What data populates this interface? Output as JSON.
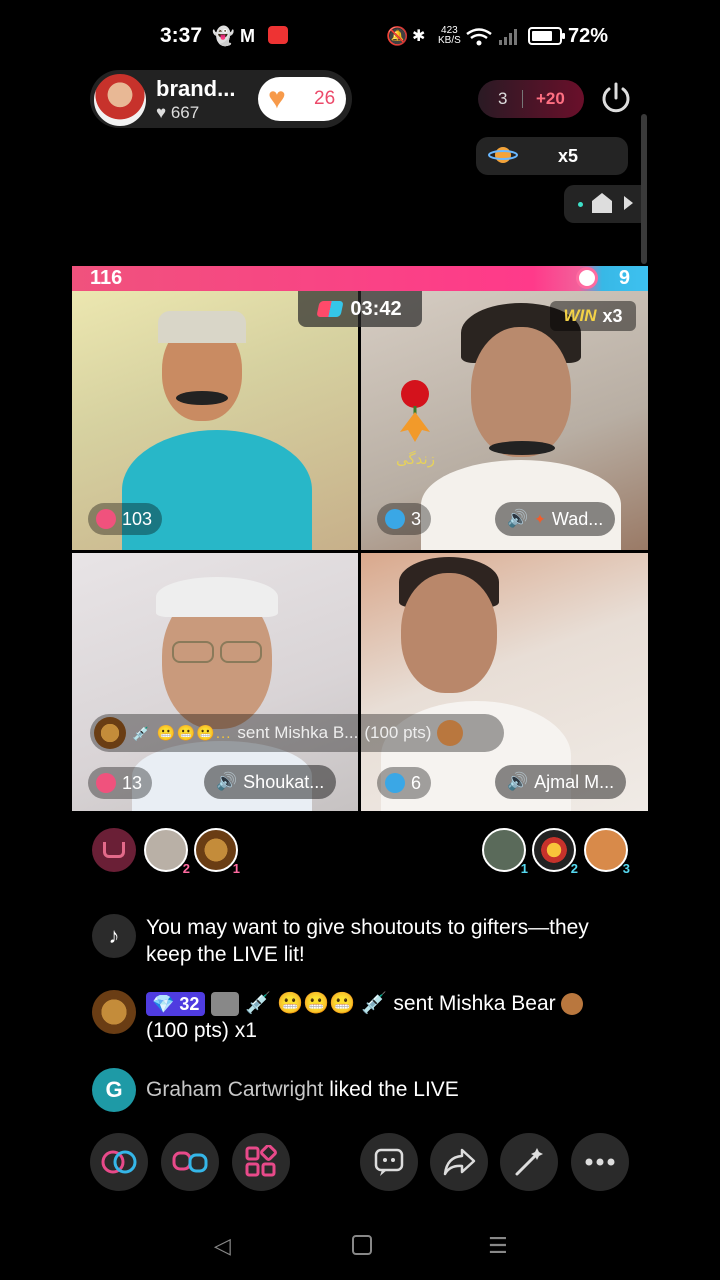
{
  "status_bar": {
    "time": "3:37",
    "net_speed_top": "423",
    "net_speed_bottom": "KB/S",
    "battery": "72%"
  },
  "host": {
    "name": "brand...",
    "likes": "667",
    "fan_count": "26"
  },
  "top_right": {
    "score_a": "3",
    "score_b": "+20",
    "planet_multiplier": "x5"
  },
  "battle": {
    "left_score": "116",
    "right_score": "9",
    "timer": "03:42",
    "win_label": "WIN",
    "win_multiplier": "x3",
    "rose_caption": "زندگی"
  },
  "tiles": [
    {
      "score": "103",
      "name": ""
    },
    {
      "score": "3",
      "name": "Wad..."
    },
    {
      "score": "13",
      "name": "Shoukat..."
    },
    {
      "score": "6",
      "name": "Ajmal M..."
    }
  ],
  "gift_banner": {
    "emojis": "💉 😬😬😬...",
    "text": "sent Mishka B...",
    "points": "(100 pts)"
  },
  "viewers_left": [
    {
      "rank": "2"
    },
    {
      "rank": "1"
    }
  ],
  "viewers_right": [
    {
      "rank": "1"
    },
    {
      "rank": "2"
    },
    {
      "rank": "3"
    }
  ],
  "comments": {
    "tip": "You may want to give shoutouts to gifters—they keep the LIVE lit!",
    "gift_level": "32",
    "gift_icons": "💉 😬😬😬 💉",
    "gift_text": "sent Mishka Bear",
    "gift_points": "(100 pts) x1",
    "like_avatar_letter": "G",
    "like_user": "Graham Cartwright",
    "like_text": "liked the LIVE"
  },
  "colors": {
    "accent_pink": "#f0527d",
    "accent_cyan": "#3aa7e6",
    "win_gold": "#f3d247"
  }
}
